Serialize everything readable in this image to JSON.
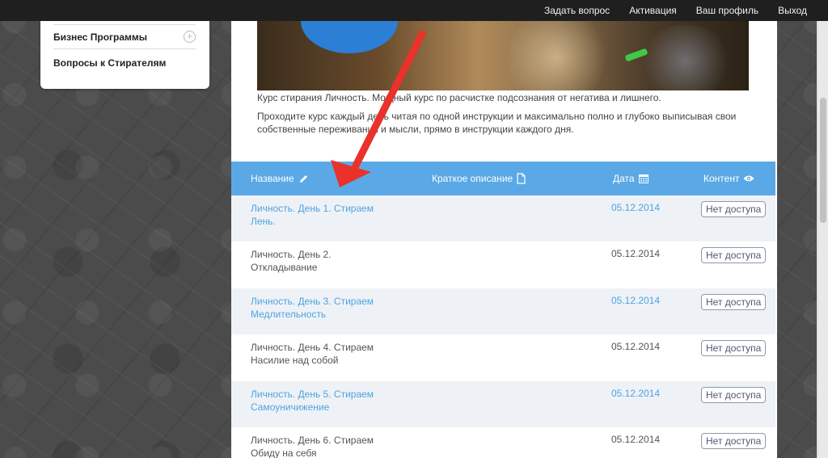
{
  "topbar": {
    "links": [
      "Задать вопрос",
      "Активация",
      "Ваш профиль",
      "Выход"
    ]
  },
  "sidebar": {
    "items": [
      {
        "label": "Бизнес Программы",
        "icon": "plus-circle-icon"
      },
      {
        "label": "Вопросы к Стирателям"
      }
    ]
  },
  "course": {
    "description": "Курс стирания Личность. Мощный курс по расчистке подсознания от негатива и лишнего.",
    "instructions": "Проходите курс каждый день читая по одной инструкции и максимально полно и глубоко выписывая свои собственные переживания и мысли, прямо в инструкции каждого дня."
  },
  "table": {
    "columns": [
      {
        "label": "Название",
        "icon": "pencil-icon"
      },
      {
        "label": "Краткое описание",
        "icon": "document-icon"
      },
      {
        "label": "Дата",
        "icon": "calendar-icon"
      },
      {
        "label": "Контент",
        "icon": "eye-icon"
      }
    ],
    "rows": [
      {
        "name": "Личность. День 1. Стираем Лень.",
        "date": "05.12.2014",
        "access": "Нет доступа"
      },
      {
        "name": "Личность. День 2. Откладывание",
        "date": "05.12.2014",
        "access": "Нет доступа"
      },
      {
        "name": "Личность. День 3. Стираем Медлительность",
        "date": "05.12.2014",
        "access": "Нет доступа"
      },
      {
        "name": "Личность. День 4. Стираем Насилие над собой",
        "date": "05.12.2014",
        "access": "Нет доступа"
      },
      {
        "name": "Личность. День 5. Стираем Самоуничижение",
        "date": "05.12.2014",
        "access": "Нет доступа"
      },
      {
        "name": "Личность. День 6. Стираем Обиду на себя",
        "date": "05.12.2014",
        "access": "Нет доступа"
      }
    ]
  },
  "colors": {
    "header_blue": "#5aa9e6",
    "link_blue": "#4fa3e0",
    "annotation_red": "#e8322a",
    "topbar": "#1f1f1f"
  }
}
